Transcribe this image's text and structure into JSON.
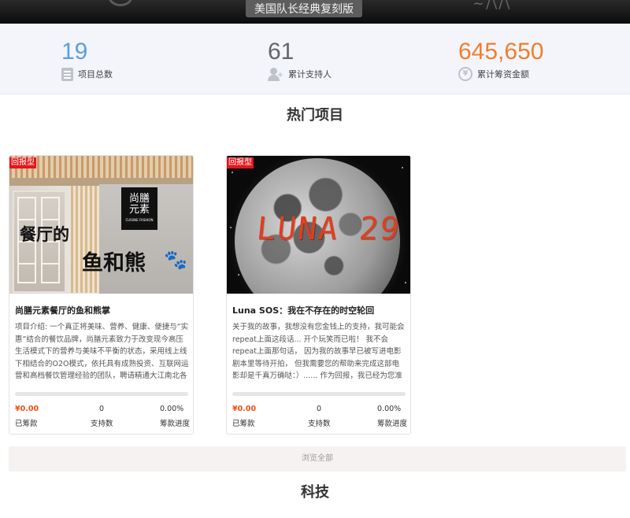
{
  "banner": {
    "title": "美国队长经典复刻版"
  },
  "stats": [
    {
      "value": "19",
      "label": "项目总数",
      "icon": "document-icon",
      "color": "#5a9fe0"
    },
    {
      "value": "61",
      "label": "累计支持人",
      "icon": "add-user-icon",
      "color": "#666666"
    },
    {
      "value": "645,650",
      "label": "累计筹资金额",
      "icon": "yuan-coin-icon",
      "color": "#f07d2c"
    }
  ],
  "sections": {
    "hot": "热门项目",
    "tech": "科技"
  },
  "projects": [
    {
      "badge": "回报型",
      "image_text": {
        "main": "餐厅的",
        "logo_top": "尚膳",
        "logo_bottom": "元素",
        "logo_en": "CUISINE FASHION",
        "sub": "鱼和熊"
      },
      "title": "尚膳元素餐厅的鱼和熊掌",
      "description": "项目介绍: 一个真正将美味、营养、健康、便捷与“实惠”结合的餐饮品牌，尚膳元素致力于改变现今高压生活模式下的营养与美味不平衡的状态，采用线上线下相结合的O2O模式，依托具有成熟投资、互联网运营和高档餐饮管理经验的团队，聘请精通大江南北各种菜系的厨务队",
      "progress": 0,
      "raised": "¥0.00",
      "raised_label": "已筹款",
      "supporters": "0",
      "supporters_label": "支持数",
      "percent": "0.00%",
      "percent_label": "筹款进度"
    },
    {
      "badge": "回报型",
      "image_text": {
        "main": "LUNA 29"
      },
      "title": "Luna SOS：我在不存在的时空轮回",
      "description": "关于我的故事，我想没有您金钱上的支持，我可能会repeat上面这段话... 开个玩笑而已啦！ 我不会repeat上面那句话， 因为我的故事早已被写进电影剧本里等待开拍， 但我需要您的帮助来完成这部电影却是千真万确哒：）...... 作为回报，我已经为您准备了丰厚的礼品：",
      "progress": 0,
      "raised": "¥0.00",
      "raised_label": "已筹款",
      "supporters": "0",
      "supporters_label": "支持数",
      "percent": "0.00%",
      "percent_label": "筹款进度"
    }
  ],
  "browse_all": "浏览全部",
  "colors": {
    "accent_orange": "#f04e12",
    "badge_red": "#e4161b",
    "stats_bg": "#f3f5fb"
  }
}
